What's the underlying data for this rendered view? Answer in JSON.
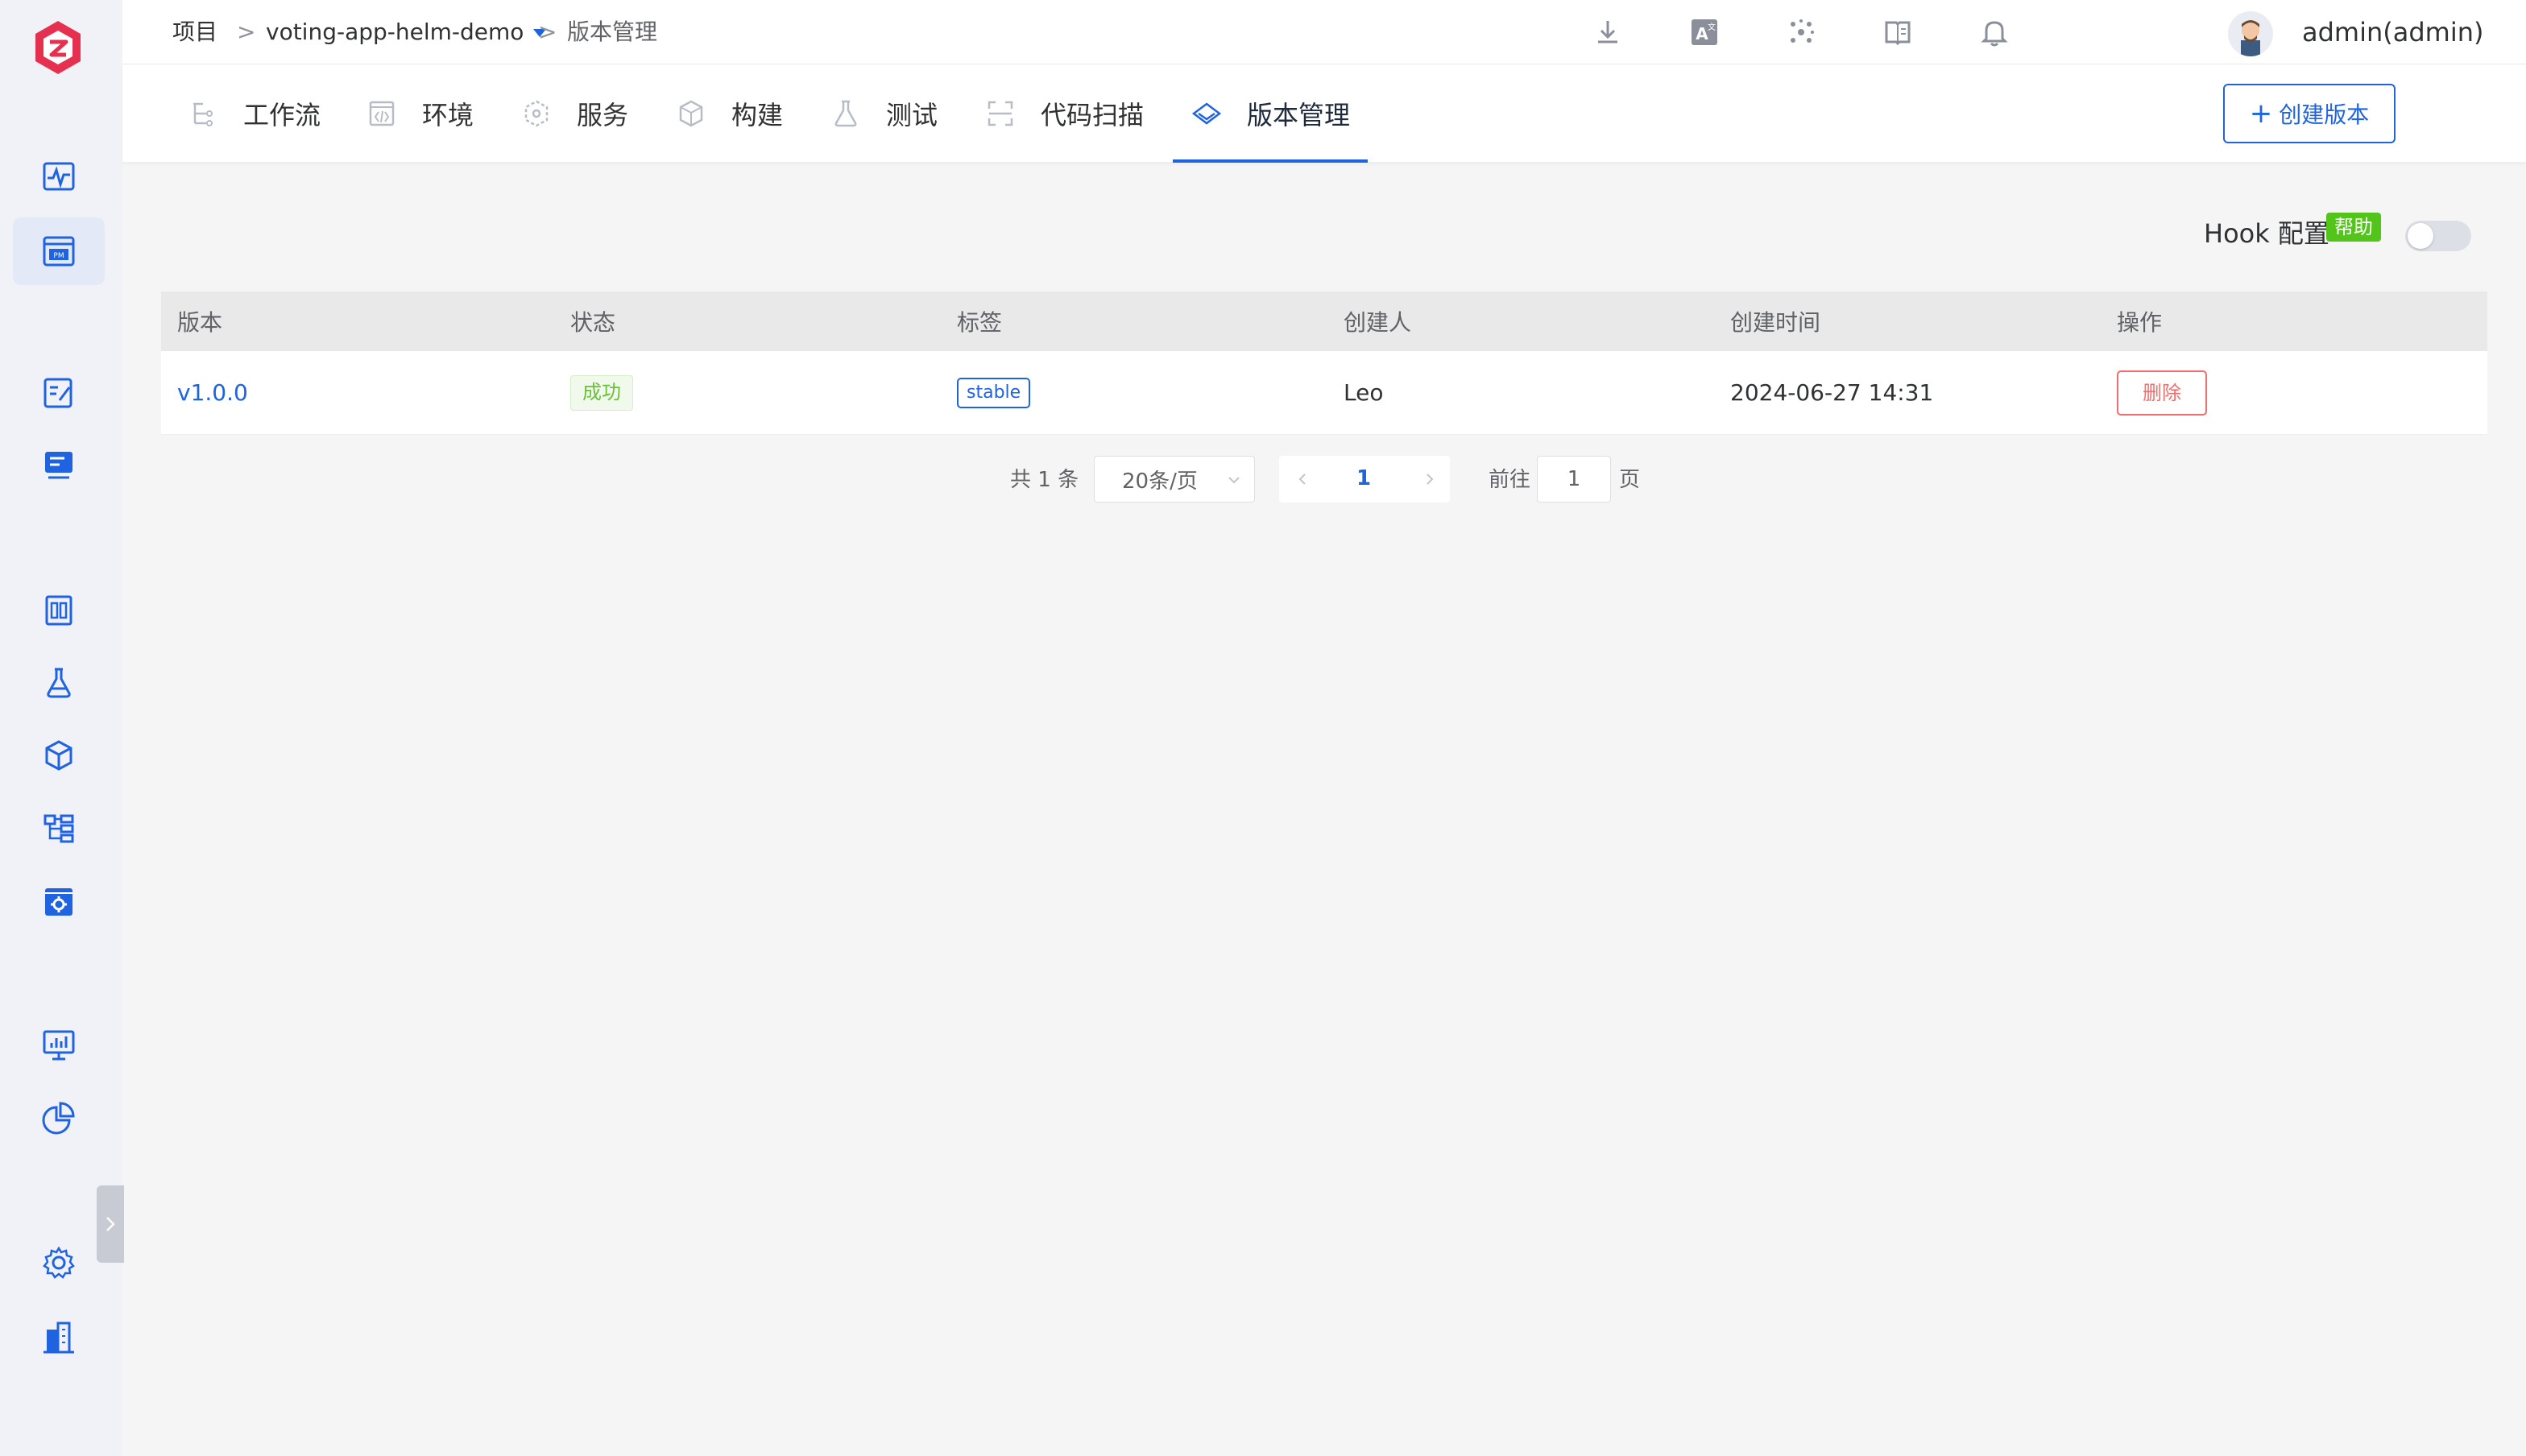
{
  "breadcrumb": {
    "root": "项目",
    "sep1": ">",
    "project": "voting-app-helm-demo",
    "sep2": ">",
    "current": "版本管理"
  },
  "user": {
    "name": "admin(admin)"
  },
  "tabs": [
    {
      "label": "工作流",
      "icon": "workflow-icon"
    },
    {
      "label": "环境",
      "icon": "environment-icon"
    },
    {
      "label": "服务",
      "icon": "service-icon"
    },
    {
      "label": "构建",
      "icon": "build-icon"
    },
    {
      "label": "测试",
      "icon": "test-flask-icon"
    },
    {
      "label": "代码扫描",
      "icon": "code-scan-icon"
    },
    {
      "label": "版本管理",
      "icon": "version-icon",
      "active": true
    }
  ],
  "create_button": {
    "plus": "+",
    "label": "创建版本"
  },
  "hook": {
    "label": "Hook 配置",
    "help": "帮助",
    "enabled": false
  },
  "table": {
    "headers": [
      "版本",
      "状态",
      "标签",
      "创建人",
      "创建时间",
      "操作"
    ],
    "rows": [
      {
        "version": "v1.0.0",
        "status": "成功",
        "tag": "stable",
        "creator": "Leo",
        "created_at": "2024-06-27 14:31",
        "action": "删除"
      }
    ]
  },
  "pagination": {
    "total": "共 1 条",
    "page_size": "20条/页",
    "current_page": "1",
    "goto_label": "前往",
    "goto_value": "1",
    "page_suffix": "页"
  },
  "colors": {
    "accent": "#1f63e0",
    "success": "#67c23a",
    "danger": "#f56c6c",
    "help_badge": "#52c41a",
    "logo": "#e5314f"
  }
}
